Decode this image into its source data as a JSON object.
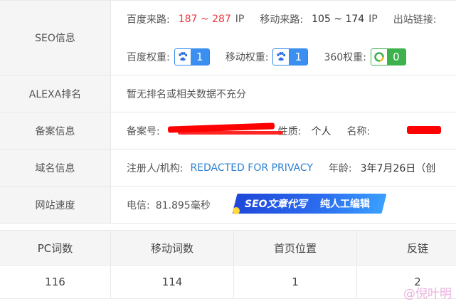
{
  "seo": {
    "label": "SEO信息",
    "baidu_traffic_label": "百度来路:",
    "baidu_traffic_value": "187 ~ 287",
    "baidu_traffic_unit": "IP",
    "mobile_traffic_label": "移动来路:",
    "mobile_traffic_value": "105 ~ 174",
    "mobile_traffic_unit": "IP",
    "outbound_label": "出站链接:",
    "baidu_weight_label": "百度权重:",
    "baidu_weight_value": "1",
    "mobile_weight_label": "移动权重:",
    "mobile_weight_value": "1",
    "weight360_label": "360权重:",
    "weight360_value": "0"
  },
  "alexa": {
    "label": "ALEXA排名",
    "value": "暂无排名或相关数据不充分"
  },
  "beian": {
    "label": "备案信息",
    "number_label": "备案号:",
    "nature_label": "性质:",
    "nature_value": "个人",
    "name_label": "名称:"
  },
  "domain": {
    "label": "域名信息",
    "registrant_label": "注册人/机构:",
    "registrant_value": "REDACTED FOR PRIVACY",
    "age_label": "年龄:",
    "age_value": "3年7月26日（创"
  },
  "speed": {
    "label": "网站速度",
    "telecom_label": "电信:",
    "telecom_value": "81.895毫秒"
  },
  "promo": {
    "left_text": "SEO文章代写",
    "right_text": "纯人工编辑"
  },
  "stats": {
    "headers": [
      "PC词数",
      "移动词数",
      "首页位置",
      "反链"
    ],
    "values": [
      "116",
      "114",
      "1",
      "2"
    ]
  },
  "watermark": "@倪叶明",
  "colors": {
    "red_text": "#e8393f",
    "link_blue": "#2f82d2",
    "badge_blue": "#3b8ff0",
    "badge_green": "#3cb14c",
    "label_bg": "#f5f5f5"
  },
  "icons": {
    "baidu": "baidu-paw-icon",
    "weight360": "360-icon"
  }
}
